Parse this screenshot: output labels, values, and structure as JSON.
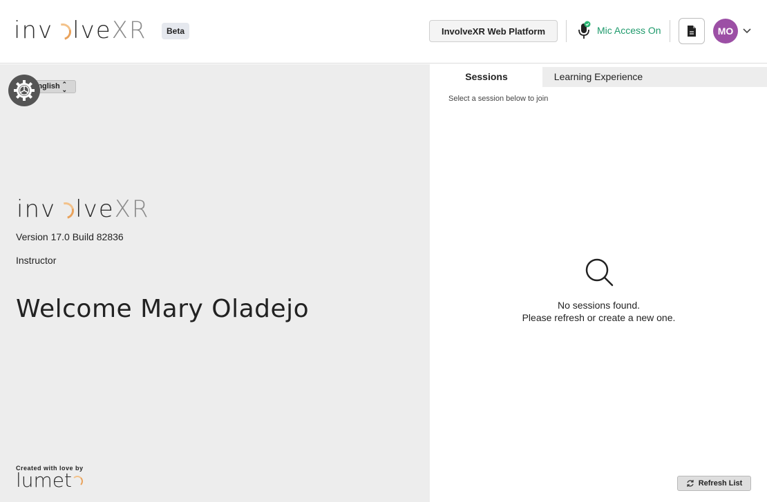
{
  "header": {
    "logo_text_main": "inv",
    "logo_text_after": "lve",
    "logo_text_xr": "XR",
    "beta_label": "Beta",
    "platform_button": "InvolveXR Web Platform",
    "mic_status": "Mic Access On",
    "avatar_initials": "MO",
    "accent_green": "#1f9a6c",
    "avatar_color": "#9c4fa5"
  },
  "left_panel": {
    "language_select_value": "English",
    "logo_text_main": "inv",
    "logo_text_after": "lve",
    "logo_text_xr": "XR",
    "version": "Version 17.0 Build 82836",
    "role": "Instructor",
    "welcome": "Welcome Mary Oladejo",
    "credit_label": "Created with love by",
    "credit_brand": "lumet"
  },
  "right_panel": {
    "tabs": [
      {
        "label": "Sessions",
        "active": true
      },
      {
        "label": "Learning Experience",
        "active": false
      }
    ],
    "hint": "Select a session below to join",
    "empty_line1": "No sessions found.",
    "empty_line2": "Please refresh or create a new one.",
    "refresh_button": "Refresh List"
  },
  "icons": [
    "settings-gear-icon",
    "microphone-icon",
    "document-icon",
    "chevron-down-icon",
    "search-icon",
    "refresh-icon"
  ]
}
